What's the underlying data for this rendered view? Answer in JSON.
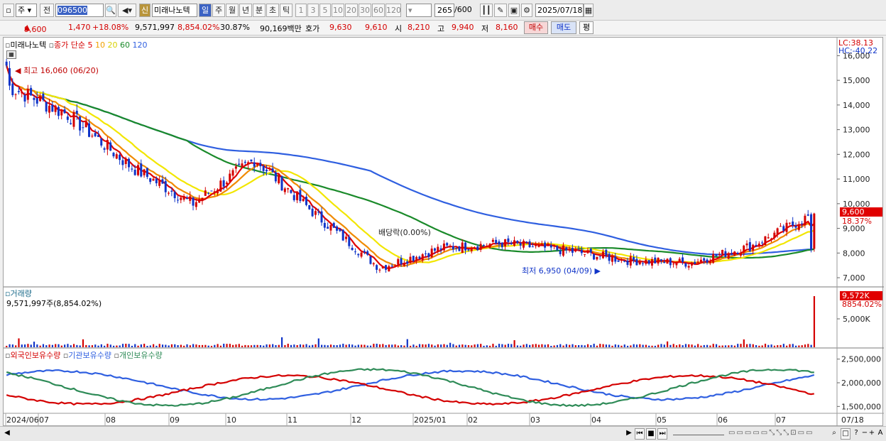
{
  "toolbar": {
    "market_select": "주",
    "prev_label": "전",
    "code": "096500",
    "new_badge": "신",
    "stock_name": "미래나노텍",
    "periods": [
      "일",
      "주",
      "월",
      "년",
      "분",
      "초",
      "틱"
    ],
    "active_period": "일",
    "intervals": [
      "1",
      "3",
      "5",
      "10",
      "20",
      "30",
      "60",
      "120"
    ],
    "count": "265",
    "count_total": "/600",
    "date": "2025/07/18"
  },
  "quote": {
    "price": "9,600",
    "change": "1,470",
    "change_pct": "+18.08%",
    "volume": "9,571,997",
    "volume_pct": "8,854.02%",
    "turnover_rate": "30.87%",
    "amount": "90,169백만",
    "hoga_label": "호가",
    "ask": "9,630",
    "bid": "9,610",
    "open_label": "시",
    "open": "8,210",
    "high_label": "고",
    "high": "9,940",
    "low_label": "저",
    "low": "8,160",
    "buy_label": "매수",
    "sell_label": "매도",
    "eval_label": "평"
  },
  "price_panel": {
    "legend_name": "미래나노텍",
    "legend_type": "종가 단순",
    "ma_periods": [
      "5",
      "10",
      "20",
      "60",
      "120"
    ],
    "lc_label": "LC:38.13",
    "hc_label": "HC:-40.22",
    "high_annotation": "최고 16,060 (06/20)",
    "low_annotation": "최저 6,950 (04/09)",
    "dividend_annotation": "배당락(0.00%)",
    "current_price_tag": "9,600",
    "current_pct_tag": "18.37%",
    "y_ticks": [
      "16,000",
      "15,000",
      "14,000",
      "13,000",
      "12,000",
      "11,000",
      "10,000",
      "9,000",
      "8,000",
      "7,000"
    ]
  },
  "volume_panel": {
    "title": "거래량",
    "value_text": "9,571,997주(8,854.02%)",
    "tag_value": "9,572K",
    "tag_pct": "8854.02%",
    "y_ticks": [
      "5,000K"
    ]
  },
  "holding_panel": {
    "series_labels": [
      "외국인보유수량",
      "기관보유수량",
      "개인보유수량"
    ],
    "y_ticks": [
      "2,500,000",
      "2,000,000",
      "1,500,000"
    ]
  },
  "x_axis": {
    "labels": [
      "2024/06",
      "07",
      "08",
      "09",
      "10",
      "11",
      "12",
      "2025/01",
      "02",
      "03",
      "04",
      "05",
      "06",
      "07"
    ],
    "right_label": "07/18"
  },
  "colors": {
    "up": "#d40000",
    "down": "#1034c8",
    "ma5": "#e00000",
    "ma10": "#f08a00",
    "ma20": "#f2e600",
    "ma60": "#1a8a2a",
    "ma120": "#2f5fe0",
    "foreign": "#d40000",
    "institution": "#2f5fe0",
    "individual": "#2e8b57"
  },
  "chart_data": {
    "type": "candlestick",
    "x_range": [
      "2024/06",
      "2025/07/18"
    ],
    "y_range": [
      6800,
      16500
    ],
    "highest": {
      "value": 16060,
      "date": "06/20"
    },
    "lowest": {
      "value": 6950,
      "date": "04/09"
    },
    "monthly_close_approx": [
      {
        "x": "2024/06",
        "close": 14800
      },
      {
        "x": "07",
        "close": 13600
      },
      {
        "x": "08",
        "close": 11500
      },
      {
        "x": "09",
        "close": 10000
      },
      {
        "x": "10",
        "close": 11800
      },
      {
        "x": "11",
        "close": 9500
      },
      {
        "x": "12",
        "close": 7400
      },
      {
        "x": "2025/01",
        "close": 8200
      },
      {
        "x": "02",
        "close": 8400
      },
      {
        "x": "03",
        "close": 8100
      },
      {
        "x": "04",
        "close": 7700
      },
      {
        "x": "05",
        "close": 7600
      },
      {
        "x": "06",
        "close": 8300
      },
      {
        "x": "07",
        "close": 9600
      }
    ],
    "last_volume": 9571997,
    "holdings_y_range": [
      1400000,
      2600000
    ]
  }
}
